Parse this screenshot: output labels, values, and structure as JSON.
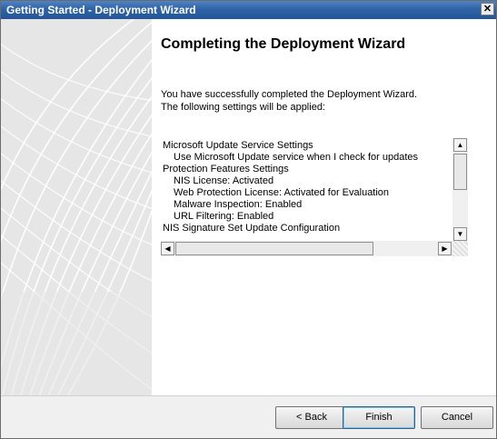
{
  "window": {
    "title": "Getting Started - Deployment Wizard",
    "close_glyph": "✕"
  },
  "heading": "Completing the Deployment Wizard",
  "description": {
    "line1": "You have successfully completed the Deployment Wizard.",
    "line2": "The following settings will be applied:"
  },
  "settings": [
    {
      "text": "Microsoft Update Service Settings",
      "indent": false
    },
    {
      "text": "Use Microsoft Update service when I check for updates",
      "indent": true
    },
    {
      "text": "Protection Features Settings",
      "indent": false
    },
    {
      "text": "NIS License: Activated",
      "indent": true
    },
    {
      "text": "Web Protection License: Activated for Evaluation",
      "indent": true
    },
    {
      "text": "Malware Inspection: Enabled",
      "indent": true
    },
    {
      "text": "URL Filtering: Enabled",
      "indent": true
    },
    {
      "text": "NIS Signature Set Update Configuration",
      "indent": false
    }
  ],
  "scrollbars": {
    "up": "▲",
    "down": "▼",
    "left": "◀",
    "right": "▶"
  },
  "footer": {
    "back_label": "< Back",
    "finish_label": "Finish",
    "cancel_label": "Cancel"
  },
  "colors": {
    "title_bar": "#2f62a6",
    "side_panel": "#e9e9e9"
  },
  "icons": {
    "close": "close-icon",
    "scroll_up": "scroll-up-arrow-icon",
    "scroll_down": "scroll-down-arrow-icon",
    "scroll_left": "scroll-left-arrow-icon",
    "scroll_right": "scroll-right-arrow-icon"
  }
}
